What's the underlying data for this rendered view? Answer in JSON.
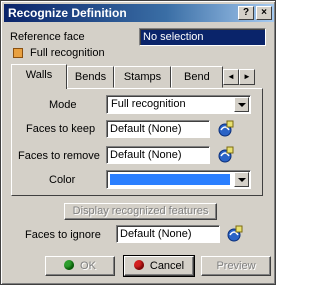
{
  "window": {
    "title": "Recognize Definition",
    "help_label": "?",
    "close_label": "×"
  },
  "reference_face": {
    "label": "Reference face",
    "value": "No selection"
  },
  "full_recognition": {
    "label": "Full recognition",
    "checked": true
  },
  "tabs": [
    {
      "label": "Walls",
      "active": true
    },
    {
      "label": "Bends"
    },
    {
      "label": "Stamps"
    },
    {
      "label": "Bend"
    }
  ],
  "tab_scroll": {
    "left": "◄",
    "right": "►"
  },
  "walls": {
    "mode": {
      "label": "Mode",
      "value": "Full recognition"
    },
    "faces_to_keep": {
      "label": "Faces to keep",
      "value": "Default (None)"
    },
    "faces_to_remove": {
      "label": "Faces to remove",
      "value": "Default (None)"
    },
    "color": {
      "label": "Color",
      "value_color": "#2b7fff"
    }
  },
  "display_button": {
    "label": "Display recognized features",
    "enabled": false
  },
  "faces_to_ignore": {
    "label": "Faces to ignore",
    "value": "Default (None)"
  },
  "buttons": {
    "ok": {
      "label": "OK",
      "enabled": false,
      "icon_color": "#2e9e2e"
    },
    "cancel": {
      "label": "Cancel",
      "icon_color": "#d42020"
    },
    "preview": {
      "label": "Preview",
      "enabled": false
    }
  }
}
